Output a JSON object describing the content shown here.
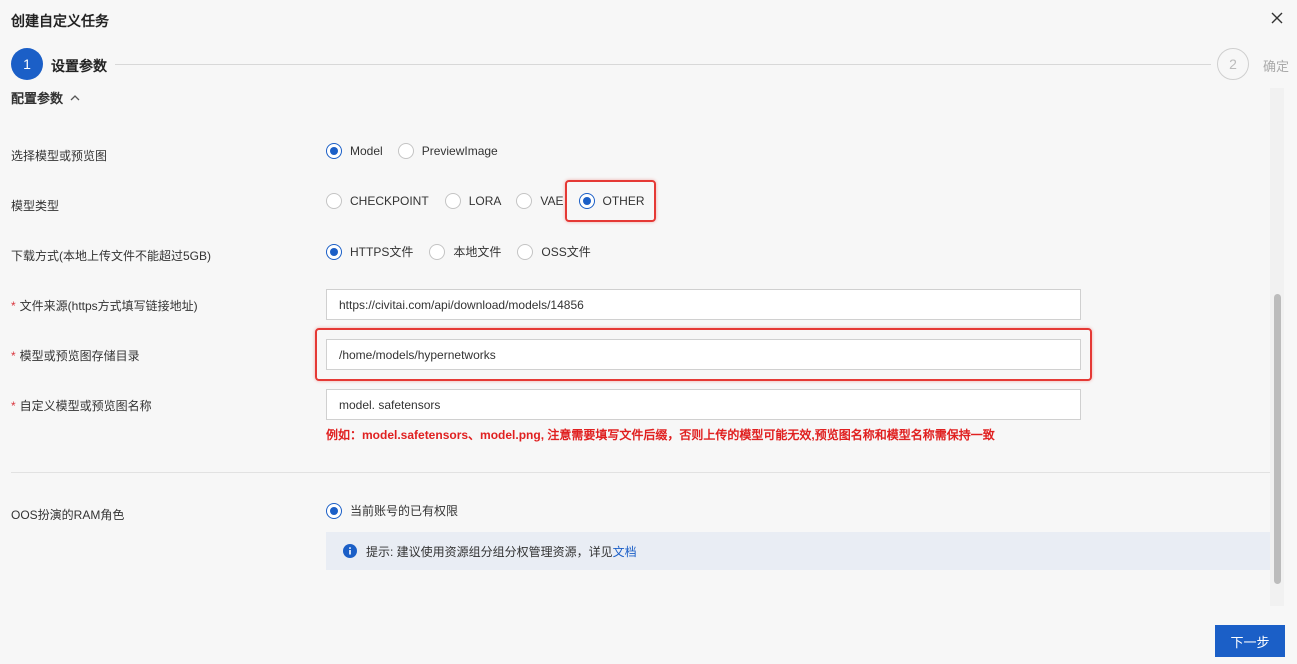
{
  "dialog": {
    "title": "创建自定义任务"
  },
  "steps": [
    {
      "number": "1",
      "label": "设置参数"
    },
    {
      "number": "2",
      "label": "确定"
    }
  ],
  "section": {
    "title": "配置参数"
  },
  "fields": {
    "select_type": {
      "label": "选择模型或预览图",
      "options": [
        "Model",
        "PreviewImage"
      ],
      "selected": "Model"
    },
    "model_type": {
      "label": "模型类型",
      "options": [
        "CHECKPOINT",
        "LORA",
        "VAE",
        "OTHER"
      ],
      "selected": "OTHER"
    },
    "download_method": {
      "label": "下载方式(本地上传文件不能超过5GB)",
      "options": [
        "HTTPS文件",
        "本地文件",
        "OSS文件"
      ],
      "selected": "HTTPS文件"
    },
    "file_source": {
      "required_mark": "*",
      "label": "文件来源(https方式填写链接地址)",
      "value": "https://civitai.com/api/download/models/14856"
    },
    "storage_dir": {
      "required_mark": "*",
      "label": "模型或预览图存储目录",
      "value": "/home/models/hypernetworks"
    },
    "custom_name": {
      "required_mark": "*",
      "label": "自定义模型或预览图名称",
      "value": "model. safetensors",
      "hint": "例如：model.safetensors、model.png, 注意需要填写文件后缀，否则上传的模型可能无效,预览图名称和模型名称需保持一致"
    },
    "ram_role": {
      "label": "OOS扮演的RAM角色",
      "options": [
        "当前账号的已有权限"
      ],
      "selected": "当前账号的已有权限"
    }
  },
  "notice": {
    "text": "提示: 建议使用资源组分组分权管理资源，详见",
    "link_text": "文档"
  },
  "footer": {
    "next_label": "下一步"
  },
  "colors": {
    "primary": "#1b5fc7",
    "highlight": "#e53935",
    "hint_red": "#e02020"
  }
}
